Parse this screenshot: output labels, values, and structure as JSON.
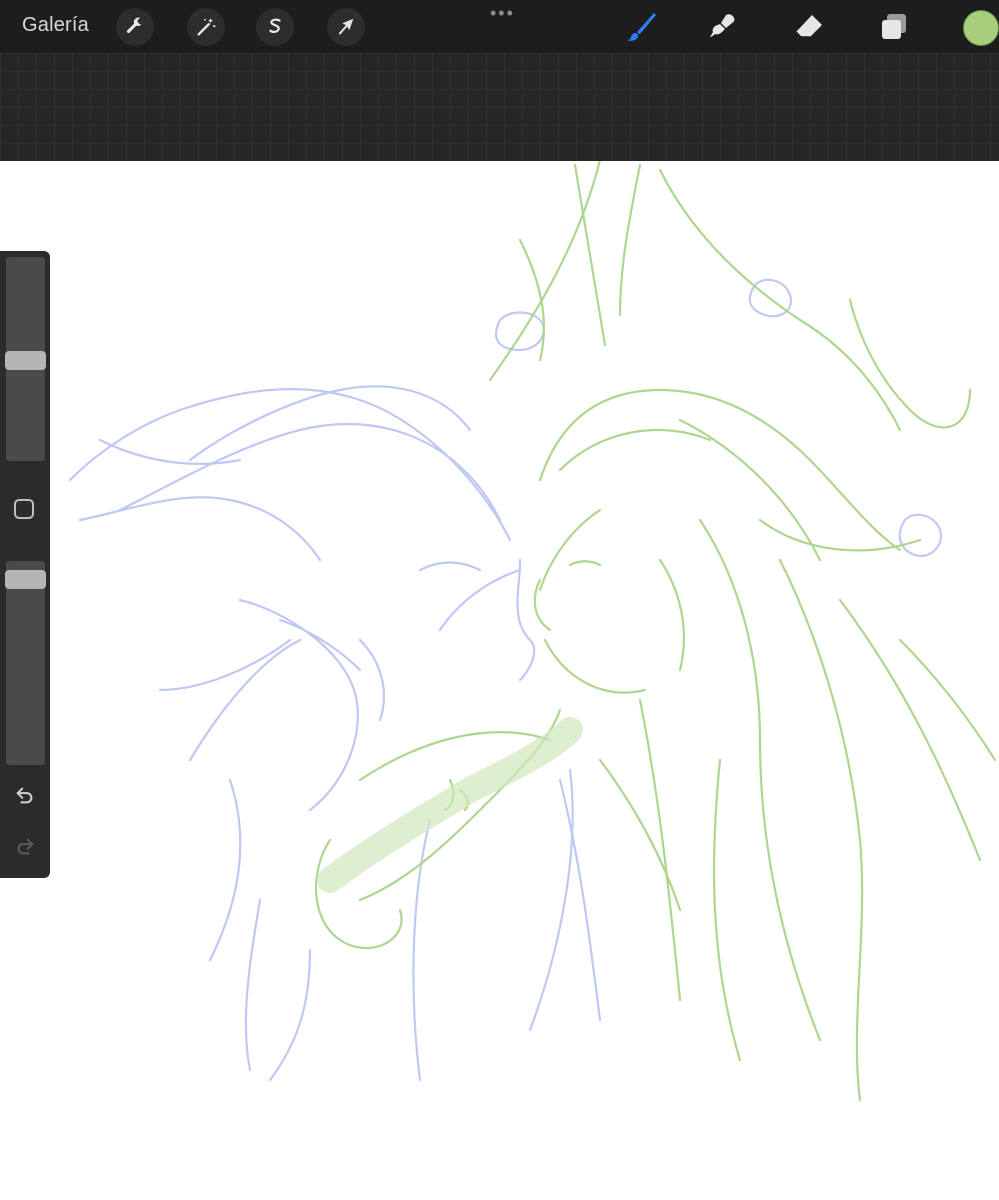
{
  "toolbar": {
    "gallery_label": "Galería",
    "left_tools": [
      "wrench-icon",
      "magic-wand-icon",
      "selection-icon",
      "transform-arrow-icon"
    ],
    "more_label": "•••",
    "right_tools": [
      "brush-icon",
      "smudge-icon",
      "eraser-icon",
      "layers-icon"
    ],
    "active_tool": "brush-icon",
    "current_color": "#a7cf7b",
    "active_color": "#2d7ff9"
  },
  "sidebar": {
    "brush_size_level": 0.49,
    "opacity_level": 0.95
  },
  "canvas": {
    "sketch_colors": [
      "#b9c3f4",
      "#a9d48b"
    ]
  }
}
